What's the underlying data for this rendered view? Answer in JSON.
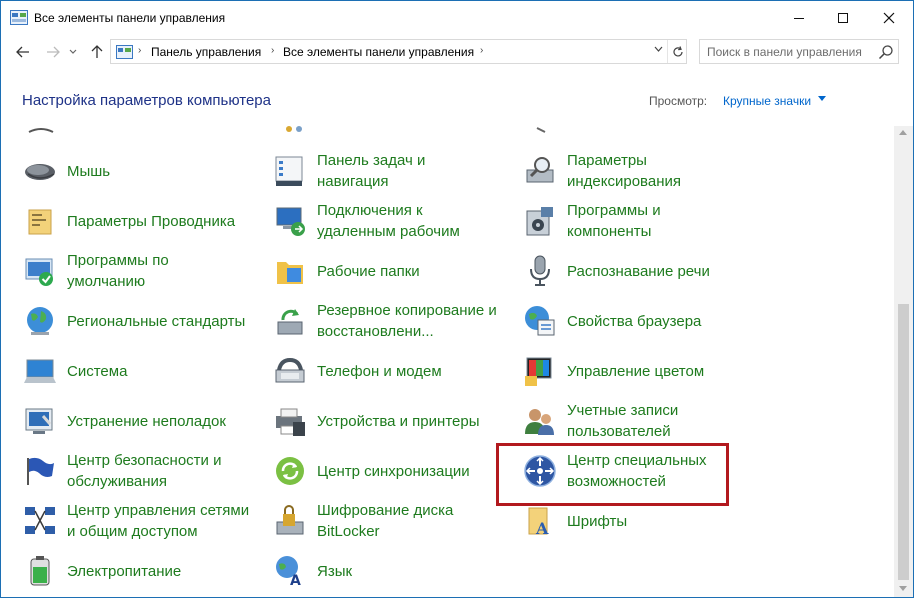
{
  "window": {
    "title": "Все элементы панели управления"
  },
  "nav": {
    "breadcrumb": [
      "Панель управления",
      "Все элементы панели управления"
    ],
    "search_placeholder": "Поиск в панели управления"
  },
  "header": {
    "title": "Настройка параметров компьютера",
    "view_label": "Просмотр:",
    "view_value": "Крупные значки"
  },
  "items": {
    "col1": [
      {
        "label": "Мышь",
        "icon": "mouse-icon"
      },
      {
        "label": "Параметры Проводника",
        "icon": "folder-options-icon"
      },
      {
        "label": "Программы по\nумолчанию",
        "icon": "default-programs-icon"
      },
      {
        "label": "Региональные стандарты",
        "icon": "region-globe-icon"
      },
      {
        "label": "Система",
        "icon": "system-monitor-icon"
      },
      {
        "label": "Устранение неполадок",
        "icon": "troubleshooting-icon"
      },
      {
        "label": "Центр безопасности и\nобслуживания",
        "icon": "security-flag-icon"
      },
      {
        "label": "Центр управления сетями\nи общим доступом",
        "icon": "network-icon"
      },
      {
        "label": "Электропитание",
        "icon": "battery-icon"
      }
    ],
    "col2": [
      {
        "label": "Панель задач и\nнавигация",
        "icon": "taskbar-icon"
      },
      {
        "label": "Подключения к\nудаленным рабочим",
        "icon": "remote-desktop-icon"
      },
      {
        "label": "Рабочие папки",
        "icon": "work-folders-icon"
      },
      {
        "label": "Резервное копирование и\nвосстановлени...",
        "icon": "backup-icon"
      },
      {
        "label": "Телефон и модем",
        "icon": "phone-modem-icon"
      },
      {
        "label": "Устройства и принтеры",
        "icon": "printer-icon"
      },
      {
        "label": "Центр синхронизации",
        "icon": "sync-center-icon"
      },
      {
        "label": "Шифрование диска\nBitLocker",
        "icon": "bitlocker-icon"
      },
      {
        "label": "Язык",
        "icon": "language-icon"
      }
    ],
    "col3": [
      {
        "label": "Параметры\nиндексирования",
        "icon": "indexing-icon"
      },
      {
        "label": "Программы и\nкомпоненты",
        "icon": "programs-features-icon"
      },
      {
        "label": "Распознавание речи",
        "icon": "microphone-icon"
      },
      {
        "label": "Свойства браузера",
        "icon": "internet-options-icon"
      },
      {
        "label": "Управление цветом",
        "icon": "color-management-icon"
      },
      {
        "label": "Учетные записи\nпользователей",
        "icon": "user-accounts-icon"
      },
      {
        "label": "Центр специальных\nвозможностей",
        "icon": "ease-of-access-icon"
      },
      {
        "label": "Шрифты",
        "icon": "fonts-icon"
      }
    ]
  },
  "colors": {
    "link_green": "#1e7b1e",
    "title_blue": "#1e3287",
    "highlight_red": "#b2191e"
  }
}
